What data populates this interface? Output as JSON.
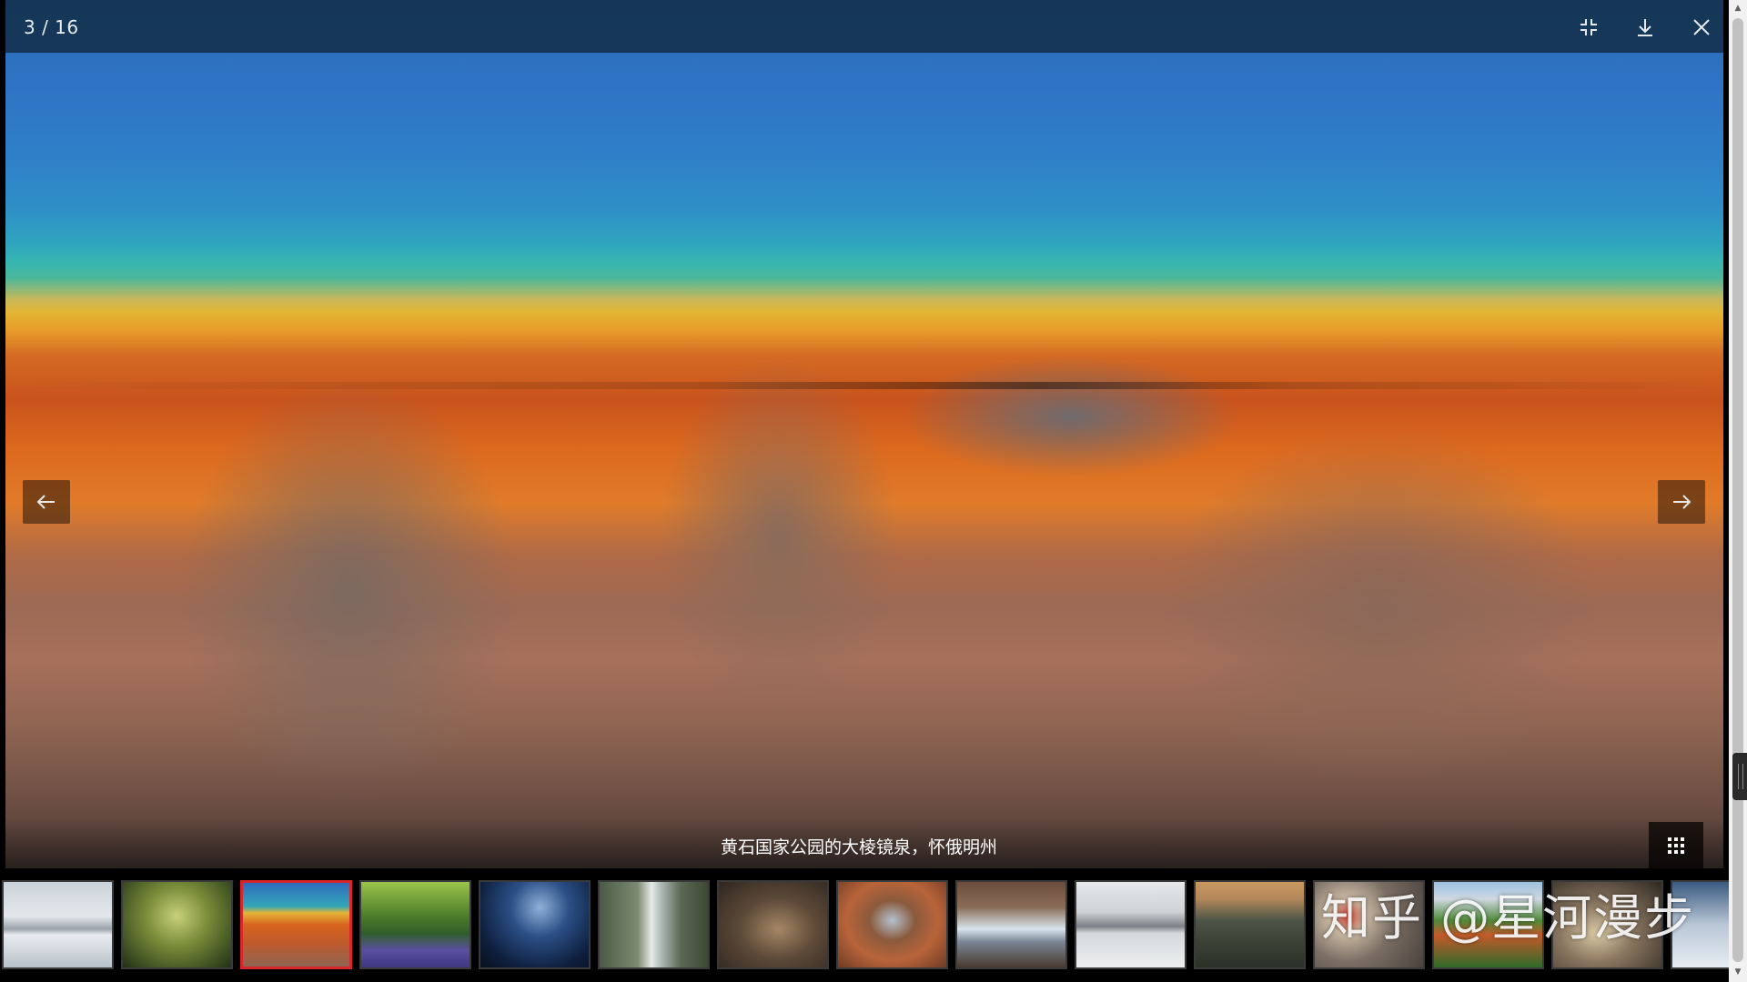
{
  "viewer": {
    "counter": "3 / 16",
    "caption": "黄石国家公园的大棱镜泉，怀俄明州",
    "watermark": "知乎 @星河漫步"
  },
  "toolbar": {
    "exit_fullscreen_icon": "compress-icon",
    "download_icon": "download-icon",
    "close_icon": "close-icon"
  },
  "navigation": {
    "prev_icon": "arrow-left-icon",
    "next_icon": "arrow-right-icon",
    "grid_icon": "grid-icon"
  },
  "thumbnails": [
    {
      "subject": "birds-on-ice"
    },
    {
      "subject": "forest-trees"
    },
    {
      "subject": "grand-prismatic-spring",
      "active": true
    },
    {
      "subject": "bluebell-forest"
    },
    {
      "subject": "night-sky-coast"
    },
    {
      "subject": "waterfall"
    },
    {
      "subject": "owl"
    },
    {
      "subject": "rock-arch"
    },
    {
      "subject": "mountain-stream"
    },
    {
      "subject": "dolphins"
    },
    {
      "subject": "mountain-sunset"
    },
    {
      "subject": "colorful-pebbles"
    },
    {
      "subject": "red-trees-hills"
    },
    {
      "subject": "animals"
    },
    {
      "subject": "water-partial"
    }
  ],
  "colors": {
    "active_thumb_border": "#d9262a",
    "topbar_bg": "#0f283c"
  }
}
